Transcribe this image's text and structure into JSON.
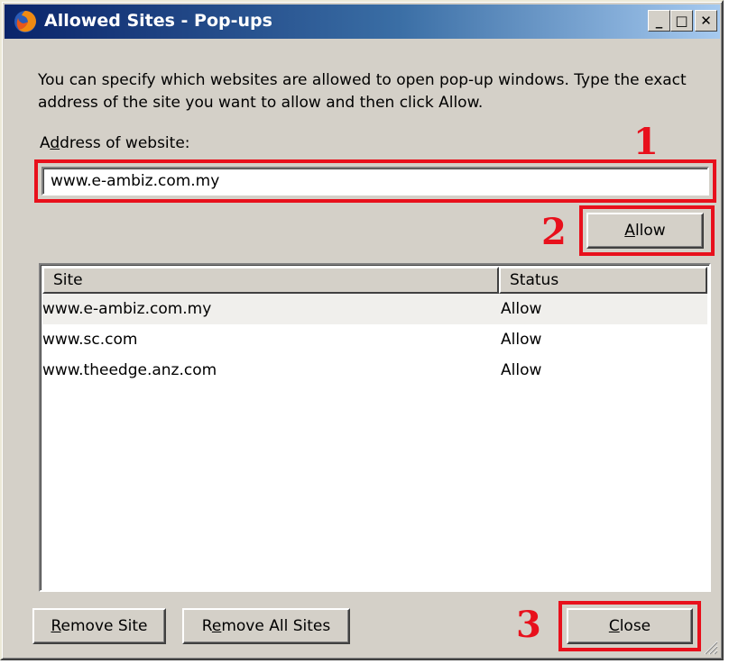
{
  "window": {
    "title": "Allowed Sites - Pop-ups",
    "controls": {
      "minimize": "_",
      "maximize": "□",
      "close": "✕"
    }
  },
  "description": "You can specify which websites are allowed to open pop-up windows. Type the exact address of the site you want to allow and then click Allow.",
  "address": {
    "label_pre": "A",
    "label_accel": "d",
    "label_post": "dress of website:",
    "value": "www.e-ambiz.com.my"
  },
  "allow_button": {
    "accel": "A",
    "rest": "llow"
  },
  "sites_list": {
    "columns": {
      "site": "Site",
      "status": "Status"
    },
    "rows": [
      {
        "site": "www.e-ambiz.com.my",
        "status": "Allow"
      },
      {
        "site": "www.sc.com",
        "status": "Allow"
      },
      {
        "site": "www.theedge.anz.com",
        "status": "Allow"
      }
    ]
  },
  "remove_site_button": {
    "accel": "R",
    "rest": "emove Site"
  },
  "remove_all_button": {
    "pre": "R",
    "accel": "e",
    "rest": "move All Sites"
  },
  "close_button": {
    "accel": "C",
    "rest": "lose"
  },
  "annotations": {
    "n1": "1",
    "n2": "2",
    "n3": "3"
  },
  "colors": {
    "highlight": "#e8101c",
    "titlebar_start": "#0a246a",
    "face": "#d4d0c8"
  },
  "icons": {
    "app": "firefox-icon",
    "resize": "resize-grip-icon"
  }
}
